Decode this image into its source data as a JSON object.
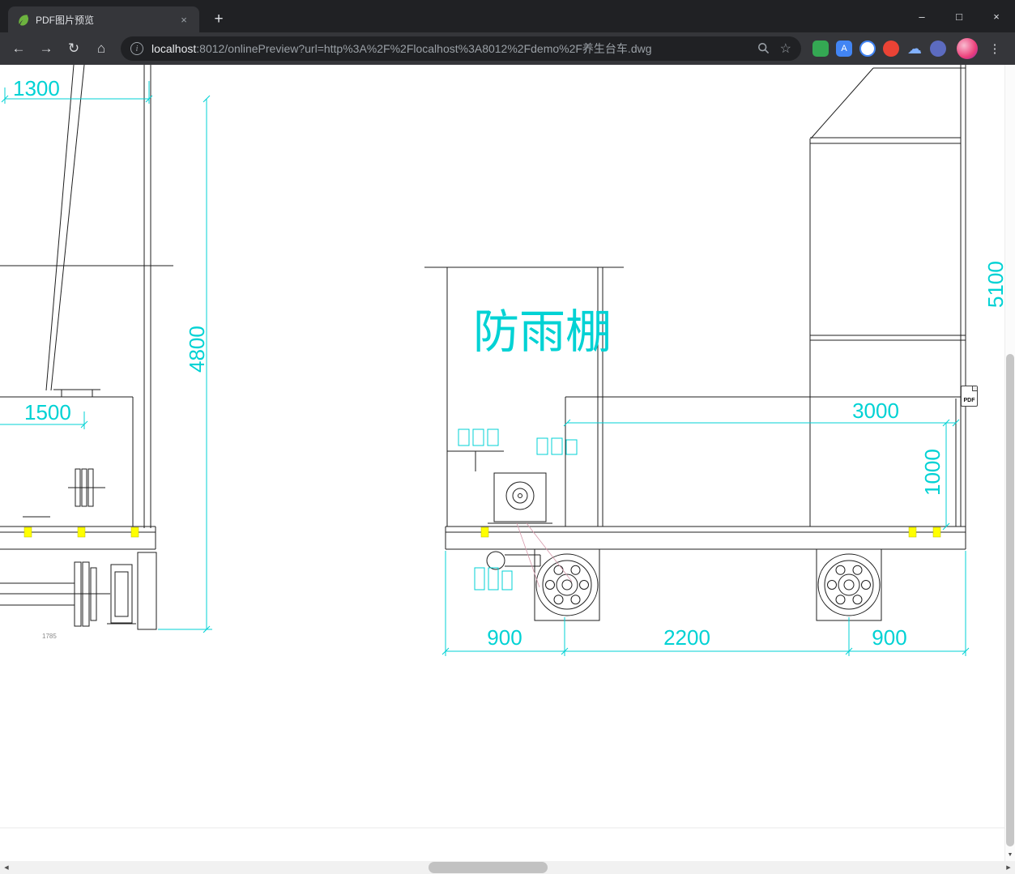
{
  "window_controls": {
    "minimize": "–",
    "maximize": "□",
    "close": "×"
  },
  "tab": {
    "title": "PDF图片预览",
    "close_label": "×",
    "new_tab_label": "+"
  },
  "icons": {
    "back": "←",
    "forward": "→",
    "reload": "↻",
    "home": "⌂",
    "info": "i",
    "star": "☆",
    "cloud": "☁",
    "kebab": "⋮",
    "scroll_down": "▼",
    "scroll_left": "◀",
    "scroll_right": "▶"
  },
  "omnibox": {
    "host": "localhost",
    "path": ":8012/onlinePreview?url=http%3A%2F%2Flocalhost%3A8012%2Fdemo%2F养生台车.dwg"
  },
  "drawing": {
    "canopy_label": "防雨棚",
    "dim_1300": "1300",
    "dim_1500": "1500",
    "dim_4800": "4800",
    "dim_5100": "5100",
    "dim_3000": "3000",
    "dim_1000": "1000",
    "dim_900_left": "900",
    "dim_2200": "2200",
    "dim_900_right": "900",
    "note_1785": "1785",
    "dimension_color": "#00d2d4",
    "line_color": "#1f1f1f",
    "highlight_color": "#ffff00"
  },
  "pdf_badge": {
    "label": "PDF"
  }
}
